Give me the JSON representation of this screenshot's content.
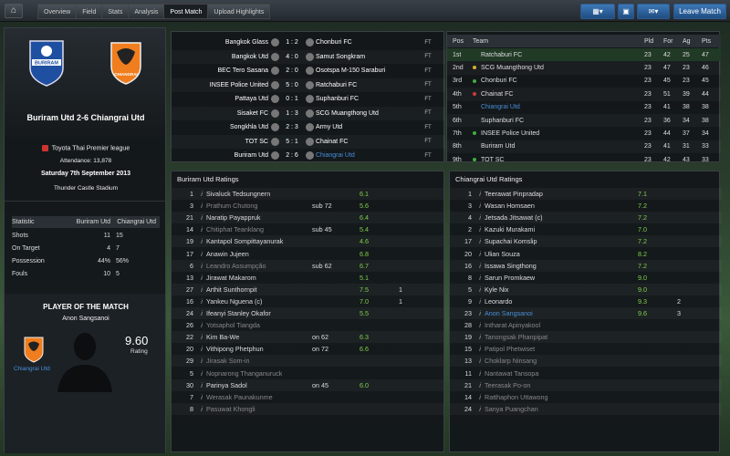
{
  "nav": {
    "tabs": [
      "Overview",
      "Field",
      "Stats",
      "Analysis",
      "Post Match",
      "Upload Highlights"
    ],
    "active_tab": "Post Match",
    "leave_match": "Leave Match"
  },
  "colors": {
    "accent": "#2f68a8",
    "rating": "#7fd14b",
    "win": "#3fae3f",
    "loss": "#d23a3a",
    "draw": "#d6b12c"
  },
  "match": {
    "title": "Buriram Utd 2-6 Chiangrai Utd",
    "competition": "Toyota Thai Premier league",
    "attendance": "Attendance: 13,878",
    "date": "Saturday 7th September 2013",
    "stadium": "Thunder Castle Stadium",
    "home_crest_text": "BURIRAM",
    "away_crest_text": "CHIANGRAI"
  },
  "stats": {
    "headers": [
      "Statistic",
      "Buriram Utd",
      "Chiangrai Utd"
    ],
    "rows": [
      [
        "Shots",
        "11",
        "15"
      ],
      [
        "On Target",
        "4",
        "7"
      ],
      [
        "Possession",
        "44%",
        "56%"
      ],
      [
        "Fouls",
        "10",
        "5"
      ]
    ]
  },
  "potm": {
    "heading": "PLAYER OF THE MATCH",
    "name": "Anon Sangsanoi",
    "club": "Chiangrai Utd",
    "rating": "9.60",
    "rating_label": "Rating"
  },
  "results": [
    {
      "home": "Bangkok Glass",
      "score": "1 : 2",
      "away": "Chonburi FC",
      "ft": "FT"
    },
    {
      "home": "Bangkok Utd",
      "score": "4 : 0",
      "away": "Samut Songkram",
      "ft": "FT"
    },
    {
      "home": "BEC Tero Sasana",
      "score": "2 : 0",
      "away": "Osotspa M-150 Saraburi",
      "ft": "FT"
    },
    {
      "home": "INSEE Police United",
      "score": "5 : 0",
      "away": "Ratchaburi FC",
      "ft": "FT"
    },
    {
      "home": "Pattaya Utd",
      "score": "0 : 1",
      "away": "Suphanburi FC",
      "ft": "FT"
    },
    {
      "home": "Sisaket FC",
      "score": "1 : 3",
      "away": "SCG Muangthong Utd",
      "ft": "FT"
    },
    {
      "home": "Songkhla Utd",
      "score": "2 : 3",
      "away": "Army Utd",
      "ft": "FT"
    },
    {
      "home": "TOT SC",
      "score": "5 : 1",
      "away": "Chainat FC",
      "ft": "FT"
    },
    {
      "home": "Buriram Utd",
      "score": "2 : 6",
      "away": "Chiangrai Utd",
      "ft": "FT"
    }
  ],
  "league": {
    "headers": [
      "Pos",
      "Team",
      "Pld",
      "For",
      "Ag",
      "Pts"
    ],
    "rows": [
      [
        "1st",
        "Ratchaburi FC",
        "23",
        "42",
        "25",
        "47"
      ],
      [
        "2nd",
        "SCG Muangthong Utd",
        "23",
        "47",
        "23",
        "46"
      ],
      [
        "3rd",
        "Chonburi FC",
        "23",
        "45",
        "23",
        "45"
      ],
      [
        "4th",
        "Chainat FC",
        "23",
        "51",
        "39",
        "44"
      ],
      [
        "5th",
        "Chiangrai Utd",
        "23",
        "41",
        "38",
        "38"
      ],
      [
        "6th",
        "Suphanburi FC",
        "23",
        "36",
        "34",
        "38"
      ],
      [
        "7th",
        "INSEE Police United",
        "23",
        "44",
        "37",
        "34"
      ],
      [
        "8th",
        "Buriram Utd",
        "23",
        "41",
        "31",
        "33"
      ],
      [
        "9th",
        "TOT SC",
        "23",
        "42",
        "43",
        "33"
      ]
    ]
  },
  "home_ratings": {
    "title": "Buriram Utd Ratings",
    "rows": [
      [
        "1",
        "Sivaluck Tedsungnern",
        "",
        "6.1",
        "",
        ""
      ],
      [
        "3",
        "Prathum Chutong",
        "sub 72",
        "5.6",
        "",
        ""
      ],
      [
        "21",
        "Naratip Payappruk",
        "",
        "6.4",
        "",
        ""
      ],
      [
        "14",
        "Chitiphat Teanklang",
        "sub 45",
        "5.4",
        "",
        ""
      ],
      [
        "19",
        "Kantapol Sompittayanurak",
        "",
        "4.6",
        "",
        ""
      ],
      [
        "17",
        "Anawin Jujeen",
        "",
        "6.8",
        "",
        ""
      ],
      [
        "6",
        "Leandro Assumpção",
        "sub 62",
        "6.7",
        "",
        ""
      ],
      [
        "13",
        "Jirawat Makarom",
        "",
        "5.1",
        "",
        ""
      ],
      [
        "27",
        "Arthit Sunthornpit",
        "",
        "7.5",
        "1",
        ""
      ],
      [
        "16",
        "Yankeu Nguena (c)",
        "",
        "7.0",
        "1",
        ""
      ],
      [
        "24",
        "Ifeanyi Stanley Okafor",
        "",
        "5.5",
        "",
        ""
      ],
      [
        "26",
        "Yotsaphol Tiangda",
        "",
        "",
        "",
        ""
      ],
      [
        "22",
        "Kim Ba-We",
        "on 62",
        "6.3",
        "",
        ""
      ],
      [
        "20",
        "Vithipong Phetphun",
        "on 72",
        "6.6",
        "",
        ""
      ],
      [
        "29",
        "Jirasak Som-in",
        "",
        "",
        "",
        ""
      ],
      [
        "5",
        "Nopnarong Thanganuruck",
        "",
        "",
        "",
        ""
      ],
      [
        "30",
        "Parinya Sadol",
        "on 45",
        "6.0",
        "",
        ""
      ],
      [
        "7",
        "Werasak Paunakunme",
        "",
        "",
        "",
        ""
      ],
      [
        "8",
        "Pasuwat Khongli",
        "",
        "",
        "",
        ""
      ]
    ]
  },
  "away_ratings": {
    "title": "Chiangrai Utd Ratings",
    "rows": [
      [
        "1",
        "Teerawat Pinpradap",
        "",
        "7.1",
        "",
        ""
      ],
      [
        "3",
        "Wasan Homsaen",
        "",
        "7.2",
        "",
        ""
      ],
      [
        "4",
        "Jetsada Jitsawat (c)",
        "",
        "7.2",
        "",
        ""
      ],
      [
        "2",
        "Kazuki Murakami",
        "",
        "7.0",
        "",
        ""
      ],
      [
        "17",
        "Supachai Komslip",
        "",
        "7.2",
        "",
        ""
      ],
      [
        "20",
        "Ulian Souza",
        "",
        "8.2",
        "",
        ""
      ],
      [
        "16",
        "Issawa Singthong",
        "",
        "7.2",
        "",
        ""
      ],
      [
        "8",
        "Sarun Promkaew",
        "",
        "9.0",
        "",
        ""
      ],
      [
        "5",
        "Kyle Nix",
        "",
        "9.0",
        "",
        ""
      ],
      [
        "9",
        "Leonardo",
        "",
        "9.3",
        "2",
        ""
      ],
      [
        "23",
        "Anon Sangsanoi",
        "",
        "9.6",
        "3",
        ""
      ],
      [
        "28",
        "Intharat Apinyakool",
        "",
        "",
        "",
        ""
      ],
      [
        "19",
        "Tanongsak Phanpipat",
        "",
        "",
        "",
        ""
      ],
      [
        "15",
        "Patipol Phetwiset",
        "",
        "",
        "",
        ""
      ],
      [
        "13",
        "Choklarp Ninsang",
        "",
        "",
        "",
        ""
      ],
      [
        "11",
        "Nantawat Tansopa",
        "",
        "",
        "",
        ""
      ],
      [
        "21",
        "Teerasak Po-on",
        "",
        "",
        "",
        ""
      ],
      [
        "14",
        "Ratthaphon Uttawong",
        "",
        "",
        "",
        ""
      ],
      [
        "24",
        "Sanya Puangchan",
        "",
        "",
        "",
        ""
      ]
    ]
  }
}
